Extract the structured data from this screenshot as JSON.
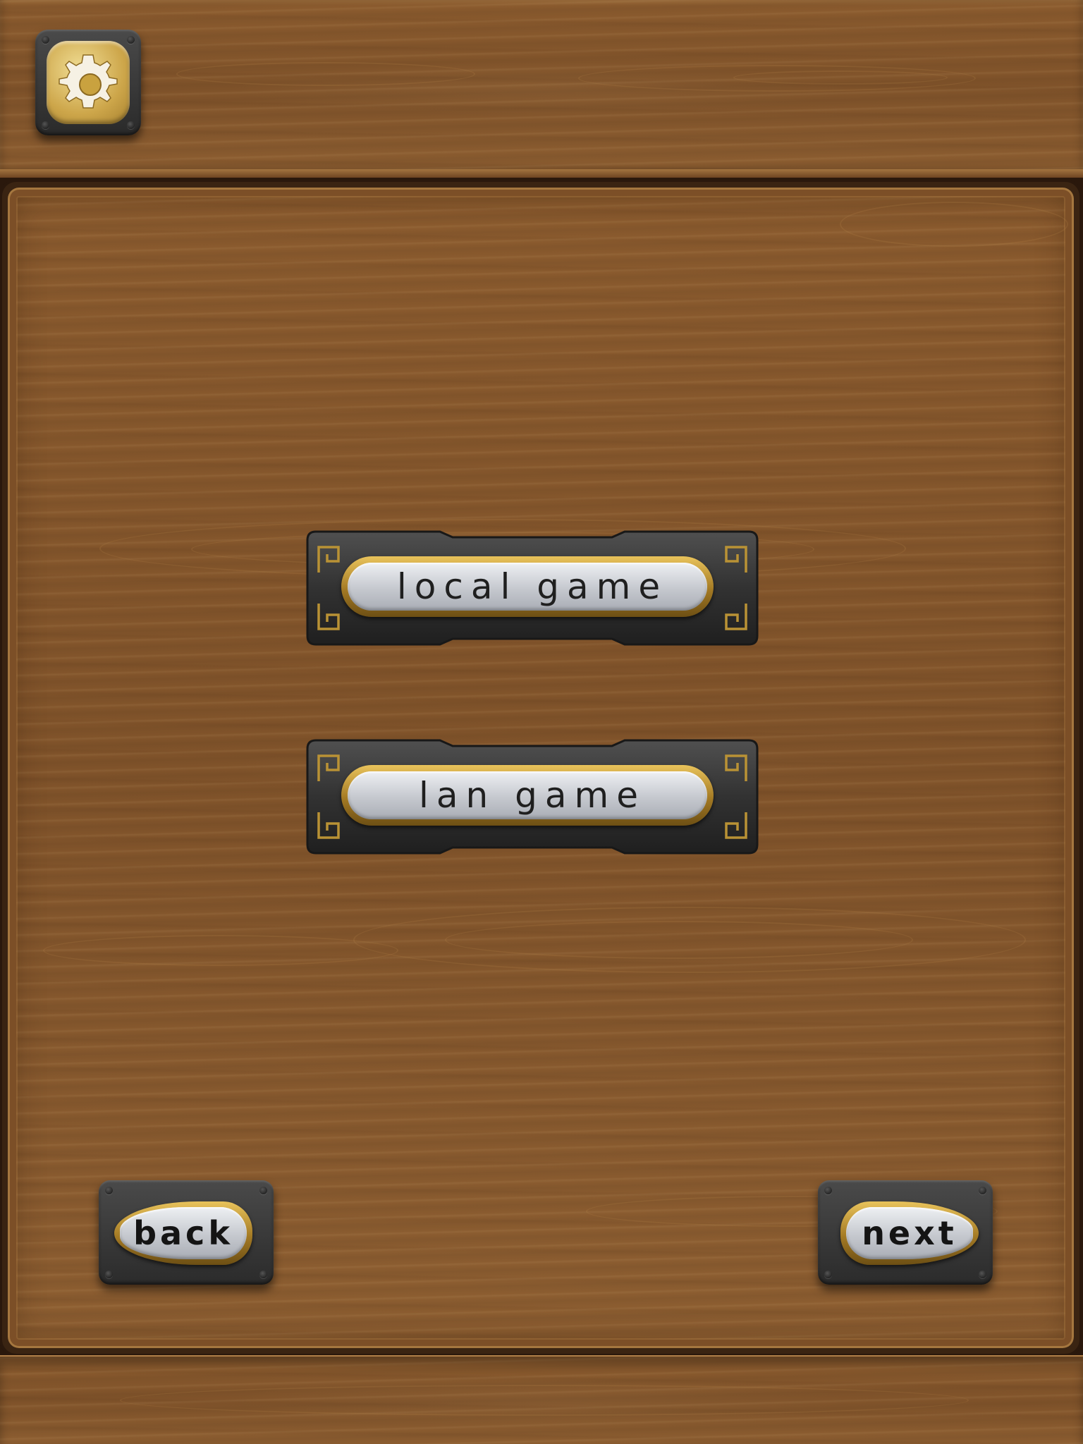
{
  "toolbar": {
    "settings_icon": "gear-icon"
  },
  "menu": {
    "items": [
      {
        "label": "local game"
      },
      {
        "label": "lan game"
      }
    ]
  },
  "navigation": {
    "back_label": "back",
    "next_label": "next"
  },
  "colors": {
    "wood": "#8a5a2e",
    "button_frame": "#333333",
    "gold_trim": "#c9a23f",
    "button_face": "#c5c8ce",
    "label_text": "#1f1f1f"
  }
}
